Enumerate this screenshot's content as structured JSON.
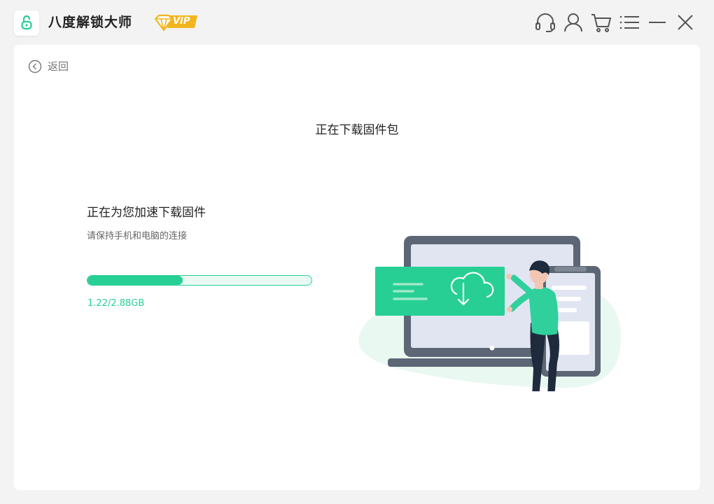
{
  "app": {
    "title": "八度解锁大师",
    "vip_label": "VIP",
    "logo_icon": "lock-icon",
    "accent_color": "#27cf95"
  },
  "window_controls": [
    {
      "name": "support",
      "icon": "headset-icon"
    },
    {
      "name": "account",
      "icon": "user-icon"
    },
    {
      "name": "cart",
      "icon": "cart-icon"
    },
    {
      "name": "menu",
      "icon": "menu-icon"
    },
    {
      "name": "minimize",
      "icon": "minimize-icon"
    },
    {
      "name": "close",
      "icon": "close-icon"
    }
  ],
  "nav": {
    "back_label": "返回",
    "back_icon": "back-arrow-icon"
  },
  "page": {
    "title": "正在下载固件包"
  },
  "download": {
    "heading": "正在为您加速下载固件",
    "subtext": "请保持手机和电脑的连接",
    "progress_text": "1.22/2.88GB",
    "downloaded_gb": 1.22,
    "total_gb": 2.88
  },
  "illustration": {
    "icon": "cloud-download-icon"
  }
}
